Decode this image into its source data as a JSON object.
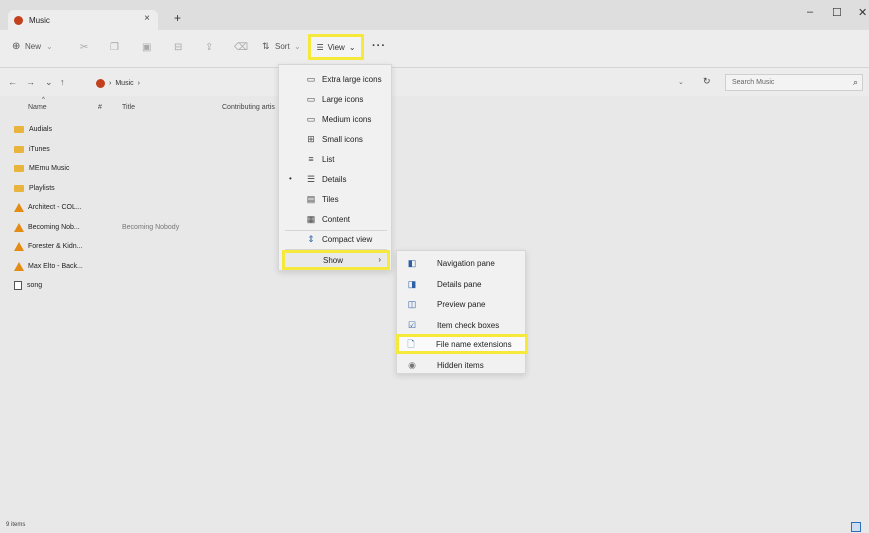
{
  "window": {
    "tab_title": "Music",
    "tab_close": "×",
    "new_tab": "+",
    "minimize": "–",
    "maximize": "☐",
    "close": "✕"
  },
  "toolbar": {
    "new_label": "New",
    "sort_label": "Sort",
    "view_label": "View",
    "more_label": "···"
  },
  "address": {
    "back": "←",
    "forward": "→",
    "recent": "⌄",
    "up": "↑",
    "breadcrumb": "Music",
    "separator": "›",
    "refresh": "↻",
    "search_placeholder": "Search Music",
    "search_icon": "⌕"
  },
  "columns": {
    "name": "Name",
    "number": "#",
    "title": "Title",
    "contributing": "Contributing artis"
  },
  "files": [
    {
      "name": "Audials",
      "type": "folder",
      "title": ""
    },
    {
      "name": "iTunes",
      "type": "folder",
      "title": ""
    },
    {
      "name": "MEmu Music",
      "type": "folder",
      "title": ""
    },
    {
      "name": "Playlists",
      "type": "folder",
      "title": ""
    },
    {
      "name": "Architect - COL...",
      "type": "vlc",
      "title": ""
    },
    {
      "name": "Becoming Nob...",
      "type": "vlc",
      "title": "Becoming Nobody"
    },
    {
      "name": "Forester & Kidn...",
      "type": "vlc",
      "title": ""
    },
    {
      "name": "Max Elto - Back...",
      "type": "vlc",
      "title": ""
    },
    {
      "name": "song",
      "type": "file",
      "title": ""
    }
  ],
  "status": {
    "count": "9 items"
  },
  "view_menu": {
    "items": [
      {
        "label": "Extra large icons",
        "icon": "monitor-icon"
      },
      {
        "label": "Large icons",
        "icon": "monitor-icon"
      },
      {
        "label": "Medium icons",
        "icon": "monitor-icon"
      },
      {
        "label": "Small icons",
        "icon": "grid-icon"
      },
      {
        "label": "List",
        "icon": "list-icon"
      },
      {
        "label": "Details",
        "icon": "details-icon",
        "selected": true
      },
      {
        "label": "Tiles",
        "icon": "tiles-icon"
      },
      {
        "label": "Content",
        "icon": "content-icon"
      },
      {
        "label": "Compact view",
        "icon": "compact-icon"
      }
    ],
    "show_label": "Show",
    "show_chevron": "›"
  },
  "show_submenu": {
    "items": [
      {
        "label": "Navigation pane",
        "icon": "navigation-pane-icon"
      },
      {
        "label": "Details pane",
        "icon": "details-pane-icon"
      },
      {
        "label": "Preview pane",
        "icon": "preview-pane-icon"
      },
      {
        "label": "Item check boxes",
        "icon": "checkbox-icon"
      },
      {
        "label": "File name extensions",
        "icon": "document-icon",
        "highlighted": true
      },
      {
        "label": "Hidden items",
        "icon": "eye-icon"
      }
    ]
  },
  "colors": {
    "highlight": "#f5e93c",
    "folder": "#e8b43c",
    "vlc": "#e58a12"
  }
}
